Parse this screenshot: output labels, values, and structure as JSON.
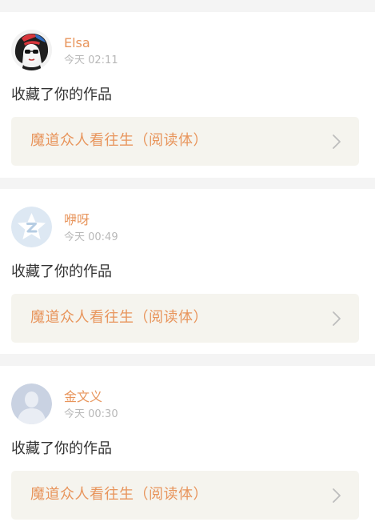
{
  "notifications": [
    {
      "avatar_icon": "woman-portrait-avatar-icon",
      "username": "Elsa",
      "timestamp": "今天 02:11",
      "action": "收藏了你的作品",
      "work_title": "魔道众人看往生（阅读体）",
      "link_icon": "chevron-right-icon"
    },
    {
      "avatar_icon": "default-star-avatar-icon",
      "username": "咿呀",
      "timestamp": "今天 00:49",
      "action": "收藏了你的作品",
      "work_title": "魔道众人看往生（阅读体）",
      "link_icon": "chevron-right-icon"
    },
    {
      "avatar_icon": "default-person-avatar-icon",
      "username": "金文义",
      "timestamp": "今天 00:30",
      "action": "收藏了你的作品",
      "work_title": "魔道众人看往生（阅读体）",
      "link_icon": "chevron-right-icon"
    }
  ],
  "colors": {
    "accent": "#e8955c",
    "muted": "#b8b8b8",
    "text": "#333333",
    "card_bg": "#ffffff",
    "page_bg": "#f4f4f4",
    "link_bg": "#f5f4ee"
  }
}
